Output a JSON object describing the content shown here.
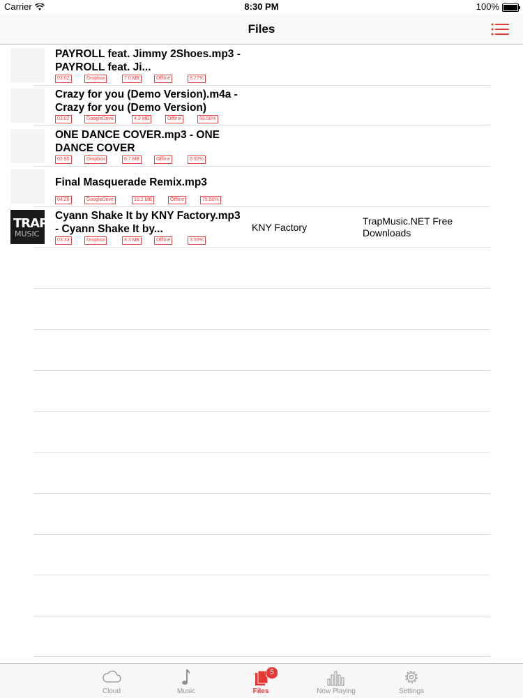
{
  "status_bar": {
    "carrier": "Carrier",
    "time": "8:30 PM",
    "battery": "100%"
  },
  "nav": {
    "title": "Files"
  },
  "files": [
    {
      "title": "PAYROLL feat. Jimmy 2Shoes.mp3 - PAYROLL feat. Ji...",
      "duration": "03:02",
      "source": "Dropbox",
      "size": "7.0 MB",
      "status": "Offline",
      "progress": "8.27%",
      "artist": "",
      "album": ""
    },
    {
      "title": "Crazy for you (Demo Version).m4a - Crazy for you (Demo Version)",
      "duration": "03:02",
      "source": "GoogleDrive",
      "size": "4.3 MB",
      "status": "Offline",
      "progress": "99.50%",
      "artist": "",
      "album": ""
    },
    {
      "title": "ONE DANCE COVER.mp3 - ONE DANCE COVER",
      "duration": "02:55",
      "source": "Dropbox",
      "size": "6.7 MB",
      "status": "Offline",
      "progress": "0.92%",
      "artist": "",
      "album": ""
    },
    {
      "title": "Final Masquerade Remix.mp3",
      "duration": "04:26",
      "source": "GoogleDrive",
      "size": "10.2 MB",
      "status": "Offline",
      "progress": "75.50%",
      "artist": "",
      "album": ""
    },
    {
      "title": "Cyann Shake It by KNY Factory.mp3 - Cyann Shake It by...",
      "duration": "03:33",
      "source": "Dropbox",
      "size": "8.3 MB",
      "status": "Offline",
      "progress": "3.55%",
      "artist": "KNY Factory",
      "album": "TrapMusic.NET Free Downloads",
      "artwork_top": "TRAP",
      "artwork_bottom": "MUSIC"
    }
  ],
  "tabs": [
    {
      "label": "Cloud",
      "icon": "cloud-icon"
    },
    {
      "label": "Music",
      "icon": "music-note-icon"
    },
    {
      "label": "Files",
      "icon": "files-icon",
      "badge": "5",
      "active": true
    },
    {
      "label": "Now Playing",
      "icon": "equalizer-icon"
    },
    {
      "label": "Settings",
      "icon": "gear-icon"
    }
  ],
  "colors": {
    "accent": "#e53935",
    "tag": "#e64545",
    "separator": "#dcdcdc",
    "inactive_tab": "#929292"
  }
}
